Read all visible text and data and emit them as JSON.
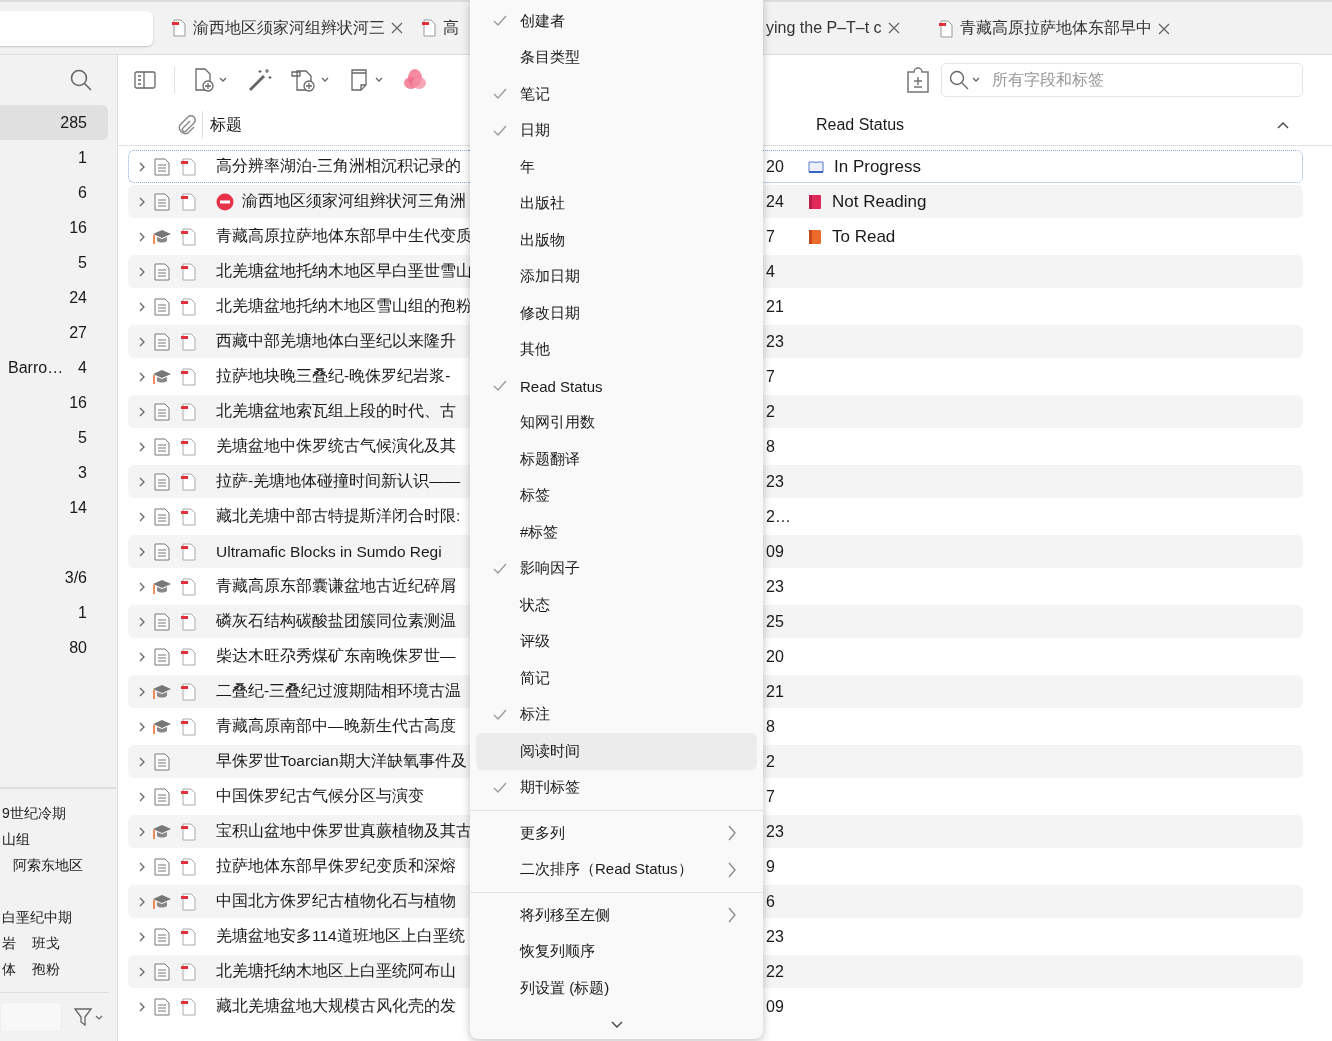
{
  "tabs": [
    {
      "title": "渝西地区须家河组辫状河三",
      "icon": true,
      "close": true
    },
    {
      "title": "高",
      "icon": true,
      "close": false
    },
    {
      "title": "ying the P–T–t c",
      "icon": false,
      "close": true
    },
    {
      "title": "青藏高原拉萨地体东部早中",
      "icon": true,
      "close": true
    }
  ],
  "sidebar": {
    "collections": [
      {
        "count": "285",
        "selected": true
      },
      {
        "count": "1",
        "selected": false
      },
      {
        "count": "6",
        "selected": false
      },
      {
        "count": "16",
        "selected": false
      },
      {
        "count": "5",
        "selected": false
      },
      {
        "count": "24",
        "selected": false
      },
      {
        "count": "27",
        "selected": false
      },
      {
        "name": "Barro…",
        "count": "4",
        "selected": false
      },
      {
        "count": "16",
        "selected": false
      },
      {
        "count": "5",
        "selected": false
      },
      {
        "count": "3",
        "selected": false
      },
      {
        "count": "14",
        "selected": false
      },
      {
        "count": "3/6",
        "selected": false
      },
      {
        "count": "1",
        "selected": false
      },
      {
        "count": "80",
        "selected": false
      }
    ],
    "tag_lines": [
      [
        "9世纪冷期"
      ],
      [
        "山组"
      ],
      [
        "阿索东地区"
      ],
      [
        "白垩纪中期"
      ],
      [
        "岩",
        "班戈"
      ],
      [
        "体",
        "孢粉"
      ]
    ]
  },
  "search": {
    "placeholder": "所有字段和标签"
  },
  "columns": {
    "title": "标题",
    "read_status": "Read Status"
  },
  "rows": [
    {
      "kind": "document",
      "pdf": true,
      "retracted": false,
      "selected": true,
      "title": "高分辨率湖泊-三角洲相沉积记录的",
      "date": "20",
      "status": {
        "kind": "in_progress",
        "label": "In Progress"
      }
    },
    {
      "kind": "document",
      "pdf": true,
      "retracted": true,
      "selected": false,
      "title": "渝西地区须家河组辫状河三角洲",
      "date": "24",
      "status": {
        "kind": "not_reading",
        "label": "Not Reading"
      }
    },
    {
      "kind": "thesis",
      "pdf": true,
      "retracted": false,
      "selected": false,
      "title": "青藏高原拉萨地体东部早中生代变质",
      "date": "7",
      "status": {
        "kind": "to_read",
        "label": "To Read"
      }
    },
    {
      "kind": "document",
      "pdf": true,
      "retracted": false,
      "selected": false,
      "title": "北羌塘盆地托纳木地区早白垩世雪山",
      "date": "4"
    },
    {
      "kind": "document",
      "pdf": true,
      "retracted": false,
      "selected": false,
      "title": "北羌塘盆地托纳木地区雪山组的孢粉",
      "date": "21"
    },
    {
      "kind": "document",
      "pdf": true,
      "retracted": false,
      "selected": false,
      "title": "西藏中部羌塘地体白垩纪以来隆升",
      "date": "23"
    },
    {
      "kind": "thesis",
      "pdf": true,
      "retracted": false,
      "selected": false,
      "title": "拉萨地块晚三叠纪-晚侏罗纪岩浆-",
      "date": "7"
    },
    {
      "kind": "document",
      "pdf": true,
      "retracted": false,
      "selected": false,
      "title": "北羌塘盆地索瓦组上段的时代、古",
      "date": "2"
    },
    {
      "kind": "document",
      "pdf": true,
      "retracted": false,
      "selected": false,
      "title": "羌塘盆地中侏罗统古气候演化及其",
      "date": "8"
    },
    {
      "kind": "document",
      "pdf": true,
      "retracted": false,
      "selected": false,
      "title": "拉萨-羌塘地体碰撞时间新认识——",
      "date": "23"
    },
    {
      "kind": "document",
      "pdf": true,
      "retracted": false,
      "selected": false,
      "title": "藏北羌塘中部古特提斯洋闭合时限:",
      "date": "2…"
    },
    {
      "kind": "document",
      "pdf": true,
      "retracted": false,
      "selected": false,
      "title": "Ultramafic Blocks in Sumdo Regi",
      "date": "09"
    },
    {
      "kind": "thesis",
      "pdf": true,
      "retracted": false,
      "selected": false,
      "title": "青藏高原东部囊谦盆地古近纪碎屑",
      "date": "23"
    },
    {
      "kind": "document",
      "pdf": true,
      "retracted": false,
      "selected": false,
      "title": "磷灰石结构碳酸盐团簇同位素测温",
      "date": "25"
    },
    {
      "kind": "document",
      "pdf": true,
      "retracted": false,
      "selected": false,
      "title": "柴达木旺尕秀煤矿东南晚侏罗世—",
      "date": "20"
    },
    {
      "kind": "thesis",
      "pdf": true,
      "retracted": false,
      "selected": false,
      "title": "二叠纪-三叠纪过渡期陆相环境古温",
      "date": "21"
    },
    {
      "kind": "thesis",
      "pdf": true,
      "retracted": false,
      "selected": false,
      "title": "青藏高原南部中—晚新生代古高度",
      "date": "8"
    },
    {
      "kind": "document",
      "pdf": false,
      "retracted": false,
      "selected": false,
      "title": "早侏罗世Toarcian期大洋缺氧事件及",
      "date": "2"
    },
    {
      "kind": "document",
      "pdf": true,
      "retracted": false,
      "selected": false,
      "title": "中国侏罗纪古气候分区与演变",
      "date": "7"
    },
    {
      "kind": "thesis",
      "pdf": true,
      "retracted": false,
      "selected": false,
      "title": "宝积山盆地中侏罗世真蕨植物及其古",
      "date": "23"
    },
    {
      "kind": "document",
      "pdf": true,
      "retracted": false,
      "selected": false,
      "title": "拉萨地体东部早侏罗纪变质和深熔",
      "date": "9"
    },
    {
      "kind": "thesis",
      "pdf": true,
      "retracted": false,
      "selected": false,
      "title": "中国北方侏罗纪古植物化石与植物",
      "date": "6"
    },
    {
      "kind": "document",
      "pdf": true,
      "retracted": false,
      "selected": false,
      "title": "羌塘盆地安多114道班地区上白垩统",
      "date": "23"
    },
    {
      "kind": "document",
      "pdf": true,
      "retracted": false,
      "selected": false,
      "title": "北羌塘托纳木地区上白垩统阿布山",
      "date": "22"
    },
    {
      "kind": "document",
      "pdf": true,
      "retracted": false,
      "selected": false,
      "title": "藏北羌塘盆地大规模古风化壳的发",
      "date": "09"
    }
  ],
  "menu": {
    "sections": [
      [
        {
          "kind": "column",
          "label": "创建者",
          "checked": true,
          "hovered": false
        },
        {
          "kind": "column",
          "label": "条目类型",
          "checked": false,
          "hovered": false
        },
        {
          "kind": "column",
          "label": "笔记",
          "checked": true,
          "hovered": false
        },
        {
          "kind": "column",
          "label": "日期",
          "checked": true,
          "hovered": false
        },
        {
          "kind": "column",
          "label": "年",
          "checked": false,
          "hovered": false
        },
        {
          "kind": "column",
          "label": "出版社",
          "checked": false,
          "hovered": false
        },
        {
          "kind": "column",
          "label": "出版物",
          "checked": false,
          "hovered": false
        },
        {
          "kind": "column",
          "label": "添加日期",
          "checked": false,
          "hovered": false
        },
        {
          "kind": "column",
          "label": "修改日期",
          "checked": false,
          "hovered": false
        },
        {
          "kind": "column",
          "label": "其他",
          "checked": false,
          "hovered": false
        },
        {
          "kind": "column",
          "label": "Read Status",
          "checked": true,
          "hovered": false
        },
        {
          "kind": "column",
          "label": "知网引用数",
          "checked": false,
          "hovered": false
        },
        {
          "kind": "column",
          "label": "标题翻译",
          "checked": false,
          "hovered": false
        },
        {
          "kind": "column",
          "label": "标签",
          "checked": false,
          "hovered": false
        },
        {
          "kind": "column",
          "label": "#标签",
          "checked": false,
          "hovered": false
        },
        {
          "kind": "column",
          "label": "影响因子",
          "checked": true,
          "hovered": false
        },
        {
          "kind": "column",
          "label": "状态",
          "checked": false,
          "hovered": false
        },
        {
          "kind": "column",
          "label": "评级",
          "checked": false,
          "hovered": false
        },
        {
          "kind": "column",
          "label": "简记",
          "checked": false,
          "hovered": false
        },
        {
          "kind": "column",
          "label": "标注",
          "checked": true,
          "hovered": false
        },
        {
          "kind": "column",
          "label": "阅读时间",
          "checked": false,
          "hovered": true
        },
        {
          "kind": "column",
          "label": "期刊标签",
          "checked": true,
          "hovered": false
        }
      ],
      [
        {
          "kind": "submenu",
          "label": "更多列"
        },
        {
          "kind": "submenu",
          "label": "二次排序（Read Status）"
        }
      ],
      [
        {
          "kind": "submenu",
          "label": "将列移至左侧"
        },
        {
          "kind": "action",
          "label": "恢复列顺序"
        },
        {
          "kind": "action",
          "label": "列设置 (标题)"
        }
      ]
    ]
  }
}
